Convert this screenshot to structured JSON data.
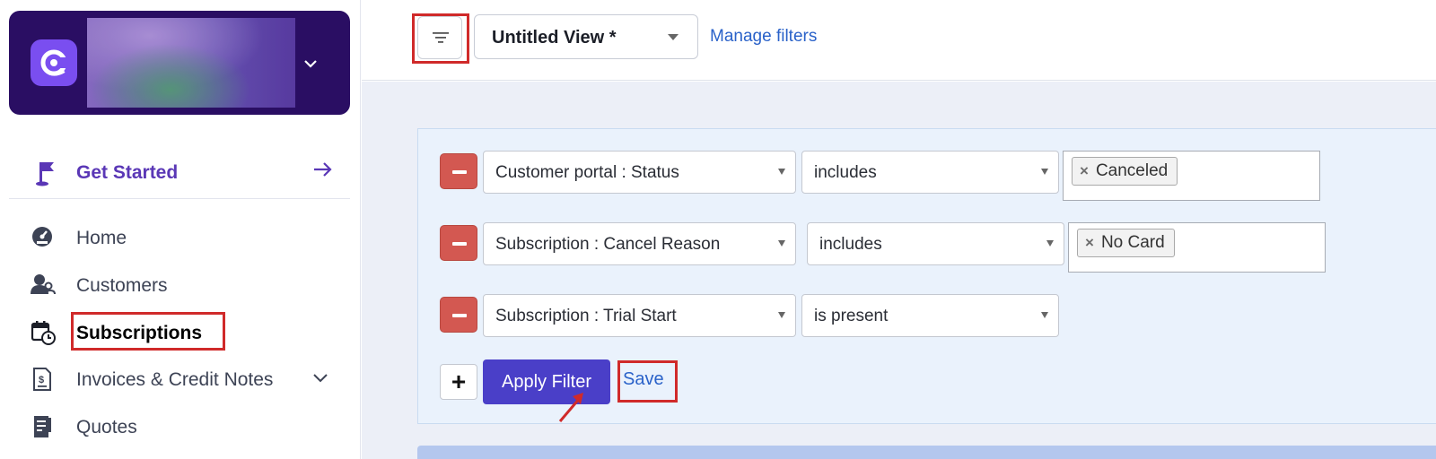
{
  "sidebar": {
    "get_started": "Get Started",
    "items": [
      {
        "label": "Home",
        "icon": "dashboard-icon"
      },
      {
        "label": "Customers",
        "icon": "customers-icon"
      },
      {
        "label": "Subscriptions",
        "icon": "calendar-clock-icon"
      },
      {
        "label": "Invoices & Credit Notes",
        "icon": "invoice-icon"
      },
      {
        "label": "Quotes",
        "icon": "quote-icon"
      }
    ]
  },
  "toolbar": {
    "view_name": "Untitled View *",
    "manage_filters": "Manage filters"
  },
  "filters": [
    {
      "field": "Customer portal : Status",
      "operator": "includes",
      "values": [
        "Canceled"
      ]
    },
    {
      "field": "Subscription : Cancel Reason",
      "operator": "includes",
      "values": [
        "No Card"
      ]
    },
    {
      "field": "Subscription : Trial Start",
      "operator": "is present",
      "values": []
    }
  ],
  "actions": {
    "add": "+",
    "apply": "Apply Filter",
    "save": "Save"
  },
  "colors": {
    "brand_dark": "#2a0e63",
    "brand_purple": "#5a37b6",
    "apply_button": "#4a3fc8",
    "remove_button": "#d35851",
    "annotation_red": "#d02a2a",
    "link": "#2a62c9"
  }
}
